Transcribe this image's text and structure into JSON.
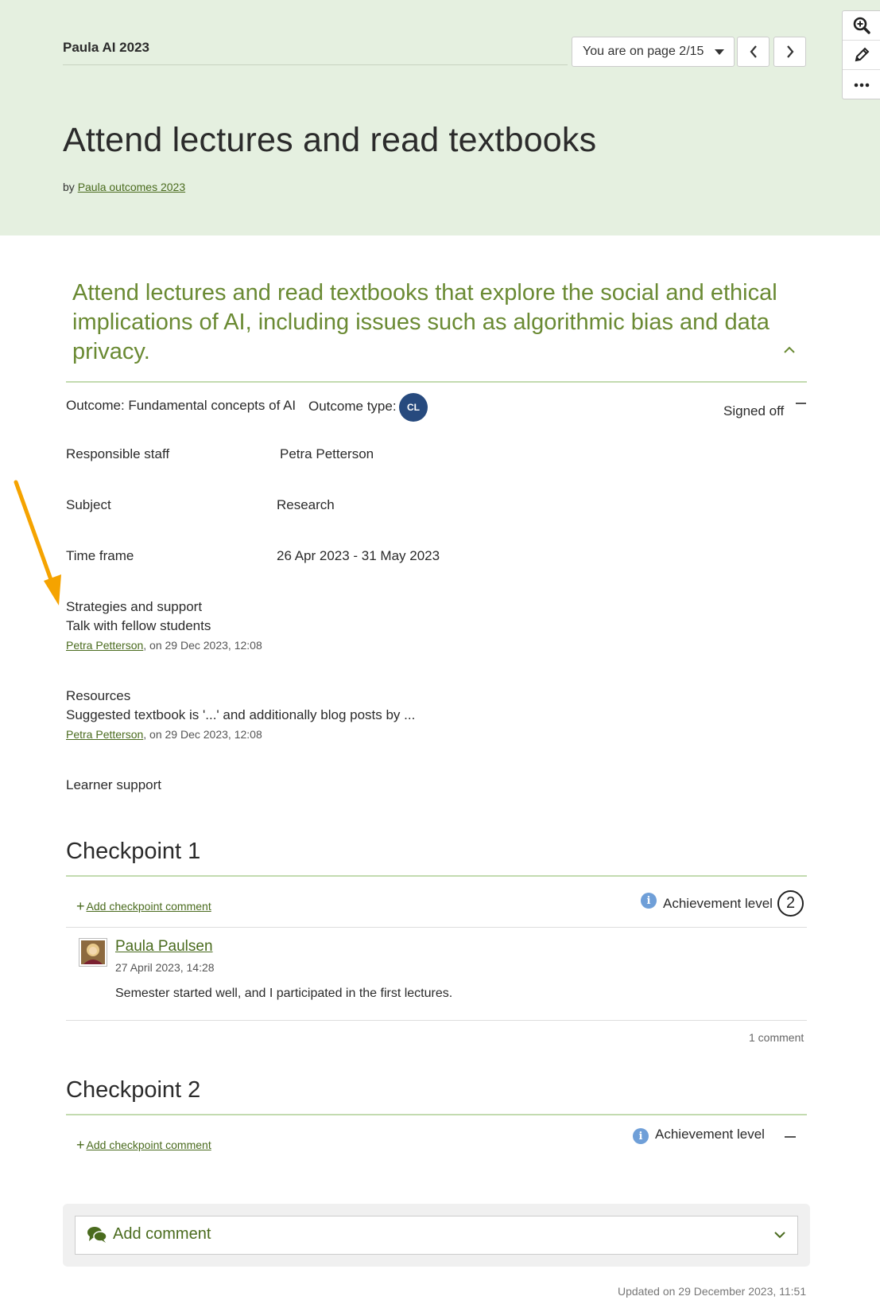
{
  "header": {
    "collection_title": "Paula AI 2023",
    "page_select": "You are on page 2/15",
    "page_title": "Attend lectures and read textbooks",
    "by_prefix": "by",
    "by_author": "Paula outcomes 2023"
  },
  "toolbar": {
    "zoom": "zoom-in-icon",
    "edit": "pencil-icon",
    "more": "more-icon"
  },
  "goal": {
    "text": "Attend lectures and read textbooks that explore the social and ethical implications of AI, including issues such as algorithmic bias and data privacy."
  },
  "outcome": {
    "outcome_label": "Outcome: Fundamental concepts of AI",
    "type_label": "Outcome type:",
    "type_badge": "CL",
    "status": "Signed off",
    "responsible_label": "Responsible staff",
    "responsible_value": "Petra Petterson",
    "subject_label": "Subject",
    "subject_value": "Research",
    "timeframe_label": "Time frame",
    "timeframe_value": "26 Apr 2023 - 31 May 2023",
    "strategies_label": "Strategies and support",
    "strategies_value": "Talk with fellow students",
    "strategies_author": "Petra Petterson",
    "strategies_meta": ", on 29 Dec 2023, 12:08",
    "resources_label": "Resources",
    "resources_value": "Suggested textbook is '...' and additionally blog posts by ...",
    "resources_author": "Petra Petterson",
    "resources_meta": ", on 29 Dec 2023, 12:08",
    "learner_support_label": "Learner support"
  },
  "checkpoints": [
    {
      "title": "Checkpoint 1",
      "add_comment": "Add checkpoint comment",
      "achievement_label": "Achievement level",
      "achievement_value": "2",
      "comment": {
        "author": "Paula Paulsen",
        "date": "27 April 2023, 14:28",
        "text": "Semester started well, and I participated in the first lectures."
      },
      "comment_count": "1 comment"
    },
    {
      "title": "Checkpoint 2",
      "add_comment": "Add checkpoint comment",
      "achievement_label": "Achievement level"
    }
  ],
  "footer": {
    "add_comment": "Add comment",
    "updated": "Updated on 29 December 2023, 11:51"
  },
  "colors": {
    "header_bg": "#e5f0e0",
    "accent_green": "#6a8a33",
    "link_green": "#4a6b1e",
    "badge_blue": "#274a7e",
    "info_blue": "#6f9fd8",
    "annotation_arrow": "#f5a300"
  }
}
